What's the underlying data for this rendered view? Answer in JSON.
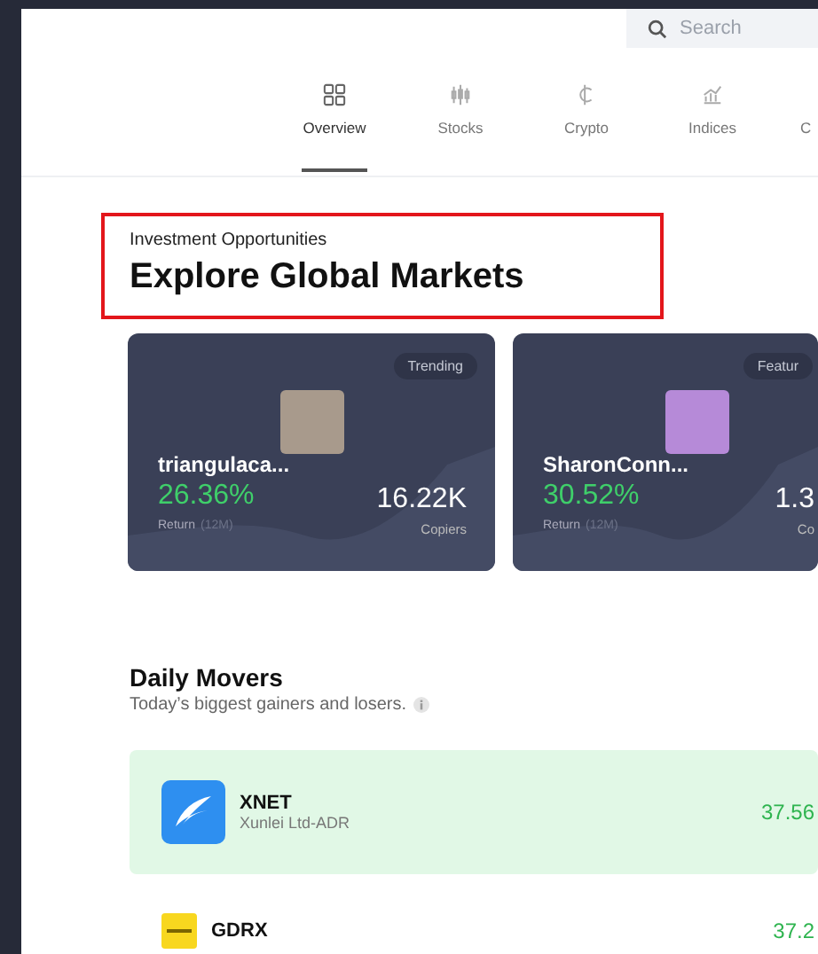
{
  "search": {
    "placeholder": "Search"
  },
  "tabs": [
    {
      "label": "Overview",
      "selected": true
    },
    {
      "label": "Stocks",
      "selected": false
    },
    {
      "label": "Crypto",
      "selected": false
    },
    {
      "label": "Indices",
      "selected": false
    },
    {
      "label": "C",
      "selected": false
    }
  ],
  "header": {
    "eyebrow": "Investment Opportunities",
    "title": "Explore Global Markets",
    "highlighted": true
  },
  "traders": [
    {
      "badge": "Trending",
      "name": "triangulaca...",
      "return": "26.36%",
      "return_label": "Return",
      "period": "(12M)",
      "copiers": "16.22K",
      "copiers_label": "Copiers"
    },
    {
      "badge": "Featur",
      "name": "SharonConn...",
      "return": "30.52%",
      "return_label": "Return",
      "period": "(12M)",
      "copiers": "1.3",
      "copiers_label": "Co"
    }
  ],
  "movers": {
    "title": "Daily Movers",
    "subtitle": "Today’s biggest gainers and losers.",
    "rows": [
      {
        "symbol": "XNET",
        "company": "Xunlei Ltd-ADR",
        "value": "37.56",
        "selected": true
      },
      {
        "symbol": "GDRX",
        "value": "37.2",
        "selected": false
      }
    ]
  }
}
